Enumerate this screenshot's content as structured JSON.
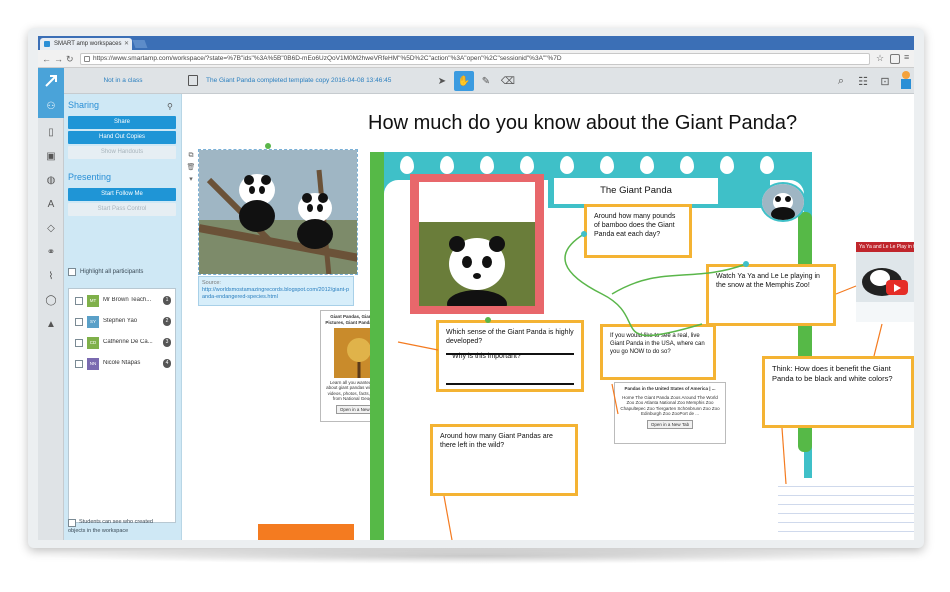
{
  "browser": {
    "tab_title": "SMART amp workspaces",
    "url": "https://www.smartamp.com/workspace/?state=%7B\"ids\"%3A%5B\"0B6D-mEo6UzQoV1M0M2hweVRfeHM\"%5D%2C\"action\"%3A\"open\"%2C\"sessionid\"%3A\"\"%7D"
  },
  "toolbar": {
    "class_status": "Not in a class",
    "document_title": "The Giant Panda completed template copy 2016-04-08 13:46:45"
  },
  "sharing_panel": {
    "sharing_heading": "Sharing",
    "share_label": "Share",
    "hand_out_label": "Hand Out Copies",
    "show_handouts_label": "Show Handouts",
    "presenting_heading": "Presenting",
    "start_follow_label": "Start Follow Me",
    "start_pass_label": "Start Pass Control",
    "highlight_label": "Highlight all participants",
    "participants": [
      {
        "initials": "MT",
        "name": "Mr Brown Teach...",
        "count": "1",
        "color": "#7fb04a"
      },
      {
        "initials": "SY",
        "name": "Stephen Yao",
        "count": "2",
        "color": "#5aa0c8"
      },
      {
        "initials": "CD",
        "name": "Catherine De Ca...",
        "count": "3",
        "color": "#7fb04a"
      },
      {
        "initials": "NN",
        "name": "Nicole Ntapas",
        "count": "4",
        "color": "#7a6ab0"
      }
    ],
    "footer_text_1": "Students can see who created",
    "footer_text_2": "objects in the workspace"
  },
  "workspace": {
    "heading": "How much do you know about the Giant Panda?",
    "source_label": "Source:",
    "source_url": "http://worldsmostamazingrecords.blogspot.com/2012/giant-panda-endangered-species.html",
    "banner_title": "The Giant Panda",
    "card_left": {
      "title": "Giant Pandas, Giant Panda Pictures, Giant Panda Facts - ...",
      "body": "Learn all you wanted to know about giant pandas with pictures, videos, photos, facts, and news from National Geographic.",
      "button": "Open in a New Tab"
    },
    "card_mid": {
      "title": "Pandas in the United States of America | ...",
      "body": "Home The Giant Panda Zoos Around The World Zoo Zoo Atlanta National Zoo Memphis Zoo Chapultepec Zoo Tiergarten Schönbrunn Zoo Zoo Edinburgh Zoo ZooPort de ...",
      "button": "Open in a New Tab"
    },
    "notes": {
      "bamboo": "Around how many pounds of bamboo does the Giant Panda eat each day?",
      "sense_q1": "Which sense of the Giant Panda is highly developed?",
      "sense_q2": "Why is this important?",
      "usa": "If you would like to see a real, live Giant Panda in the USA, where can you go NOW to do so?",
      "watch": "Watch Ya Ya and Le Le playing in the snow at the Memphis Zoo!",
      "think": "Think: How does it benefit the Giant Panda to be black and white colors?",
      "wild": "Around how many Giant Pandas are there left in the wild?"
    },
    "video_title": "Ya Ya and Le Le Play in the Snow"
  },
  "colors": {
    "accent": "#1f95d6",
    "board_teal": "#3fc0c8",
    "board_green": "#56b947",
    "note_border": "#f4b333",
    "frame_red": "#e8676b"
  },
  "icons": {
    "app": "smart-amp-logo-icon",
    "select": "arrow-cursor-icon",
    "hand": "hand-pan-icon",
    "pen": "pen-icon",
    "eraser": "eraser-icon",
    "search": "search-icon",
    "handout": "handout-icon",
    "trash": "trash-icon"
  }
}
